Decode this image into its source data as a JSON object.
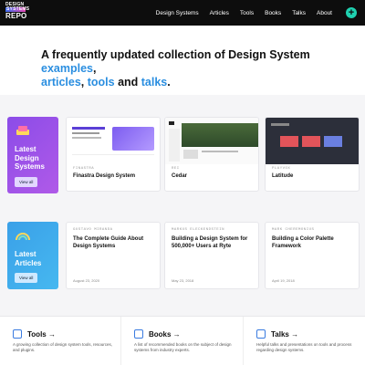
{
  "brand": {
    "logo_line1": "DESIGN",
    "logo_line2": "SYSTEMS",
    "logo_line3": "REPO"
  },
  "nav": {
    "items": [
      "Design Systems",
      "Articles",
      "Tools",
      "Books",
      "Talks",
      "About"
    ],
    "add_button": "+"
  },
  "hero": {
    "pre": "A frequently updated collection of Design System ",
    "examples": "examples",
    "comma1": ",",
    "articles": "articles",
    "comma2": ", ",
    "tools": "tools",
    "and": " and ",
    "talks": "talks",
    "end": "."
  },
  "systems": {
    "feature_title": "Latest Design Systems",
    "view_all": "View all",
    "cards": [
      {
        "category": "FINASTRA",
        "name": "Finastra Design System"
      },
      {
        "category": "REI",
        "name": "Cedar"
      },
      {
        "category": "PLAYVOX",
        "name": "Latitude"
      }
    ]
  },
  "articles": {
    "feature_title": "Latest Articles",
    "view_all": "View all",
    "cards": [
      {
        "author": "GUSTAVO MIRANDA",
        "title": "The Complete Guide About Design Systems",
        "date": "August 23, 2020"
      },
      {
        "author": "MARKUS ELECKENDSTEIN",
        "title": "Building a Design System for 500,000+ Users at Ryte",
        "date": "May 23, 2018"
      },
      {
        "author": "MARK CHEREMONIUS",
        "title": "Building a Color Palette Framework",
        "date": "April 19, 2018"
      }
    ]
  },
  "sections": [
    {
      "title": "Tools →",
      "desc": "A growing collection of design system tools, resources, and plugins."
    },
    {
      "title": "Books →",
      "desc": "A list of recommended books on the subject of design systems from industry experts."
    },
    {
      "title": "Talks →",
      "desc": "Helpful talks and presentations on tools and process regarding design systems."
    }
  ],
  "colors": {
    "accent": "#1fd1b0",
    "link": "#2a8ee0",
    "purple": "#8b4ce8",
    "blue": "#3aa0e8",
    "header": "#0d0d0d"
  }
}
